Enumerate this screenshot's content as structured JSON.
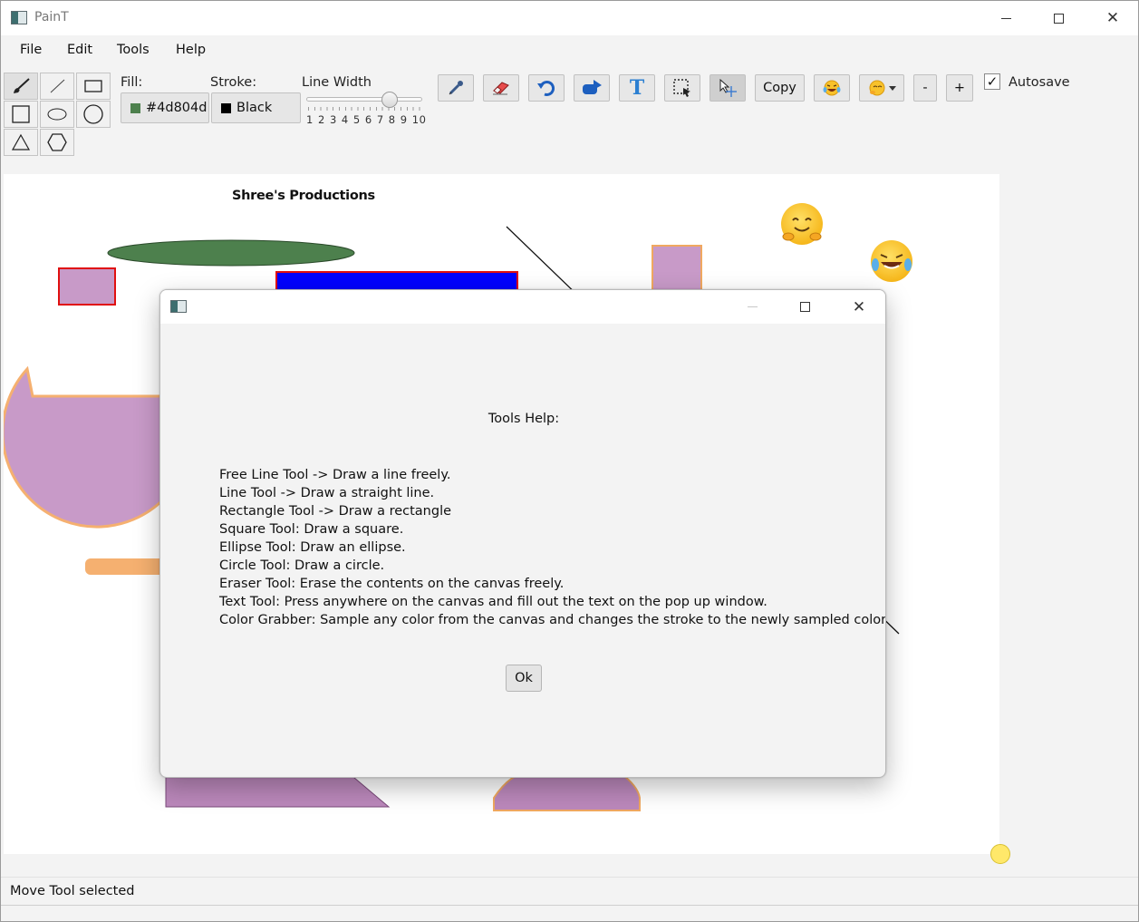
{
  "window": {
    "title": "PainT"
  },
  "menu": [
    "File",
    "Edit",
    "Tools",
    "Help"
  ],
  "toolbar": {
    "fill_label": "Fill:",
    "fill_value": "#4d804d",
    "fill_color": "#4d804d",
    "stroke_label": "Stroke:",
    "stroke_value": "Black",
    "stroke_color": "#000000",
    "line_width_label": "Line Width",
    "line_width_value": 7,
    "line_width_ticks": "1 2 3 4 5 6 7 8 9 10",
    "copy_label": "Copy",
    "minus_label": "-",
    "plus_label": "+",
    "autosave_label": "Autosave",
    "autosave_checked": true
  },
  "canvas": {
    "title_text": "Shree's Productions"
  },
  "status": {
    "text": "Move Tool selected"
  },
  "dialog": {
    "heading": "Tools Help:",
    "lines": [
      "Free Line Tool -> Draw a line freely.",
      "Line Tool -> Draw a straight line.",
      "Rectangle Tool -> Draw a rectangle",
      "Square Tool: Draw a square.",
      "Ellipse Tool: Draw an ellipse.",
      "Circle Tool: Draw a circle.",
      "Eraser Tool: Erase the contents on the canvas freely.",
      "Text Tool: Press anywhere on the canvas and fill out the text on the pop up window.",
      "Color Grabber: Sample any color from the canvas and changes the stroke to the newly sampled color."
    ],
    "ok_label": "Ok"
  }
}
